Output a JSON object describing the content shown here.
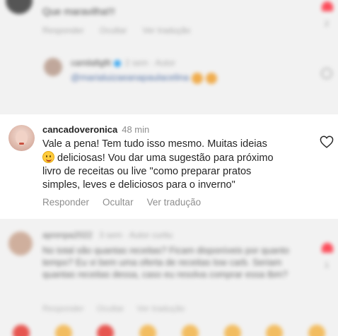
{
  "top_comment": {
    "text": "Que maravilha!!!",
    "actions": [
      "Responder",
      "Ocultar",
      "Ver tradução"
    ],
    "like_count": "2"
  },
  "reply": {
    "username": "camilafigfit",
    "meta": "2 sem · Autor",
    "mention": "@marialuizaeanapaulacelina"
  },
  "main_comment": {
    "username": "cancadoveronica",
    "time": "48 min",
    "text_line1_before_emoji": "Vale a pena! Tem tudo isso mesmo. Muitas ideias",
    "text_line2_after_emoji": " deliciosas! Vou dar uma sugestão para próximo",
    "text_line3": "livro de receitas ou live \"como preparar pratos",
    "text_line4": "simples, leves e deliciosos para o inverno\"",
    "actions": {
      "reply": "Responder",
      "hide": "Ocultar",
      "translate": "Ver tradução"
    }
  },
  "bottom_comment": {
    "username": "aprenpa2022",
    "meta": "3 sem · Autor curtiu",
    "text": "No total são quantas receitas? Ficam disponíveis por quanto tempo? Eu vi bem uma oferta de receitas low carb. Seriam quantas receitas dessa, caso eu resolva comprar essa tbm?",
    "actions": [
      "Responder",
      "Ocultar",
      "Ver tradução"
    ],
    "like_count": "1"
  },
  "colors": {
    "heart_red": "#ff3040",
    "verified_blue": "#1d9bf0",
    "mention_blue": "#3b5e9a",
    "muted_gray": "#8e8e8e"
  },
  "icons": [
    "heart-icon",
    "verified-icon",
    "smile-emoji-icon"
  ]
}
